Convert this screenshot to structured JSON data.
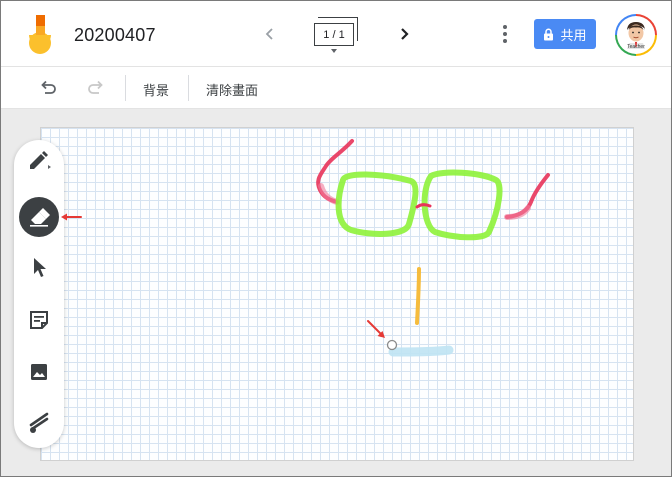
{
  "header": {
    "file_title": "20200407",
    "frame_counter": "1 / 1",
    "share_label": "共用",
    "avatar_caption": "Teacher"
  },
  "toolbar": {
    "background_label": "背景",
    "clear_label": "清除畫面"
  },
  "tools": [
    {
      "name": "pen-tool",
      "icon": "pen-icon",
      "active": false
    },
    {
      "name": "eraser-tool",
      "icon": "eraser-icon",
      "active": true
    },
    {
      "name": "select-tool",
      "icon": "cursor-arrow-icon",
      "active": false
    },
    {
      "name": "sticky-note-tool",
      "icon": "sticky-note-icon",
      "active": false
    },
    {
      "name": "image-tool",
      "icon": "image-icon",
      "active": false
    },
    {
      "name": "laser-tool",
      "icon": "laser-icon",
      "active": false
    }
  ],
  "colors": {
    "share_button": "#4a8af4",
    "active_tool": "#3c4043",
    "glasses_frame": "#8ef23a",
    "glasses_arms": "#e8335a",
    "nose": "#f5b833",
    "mouth": "#bfe3f3",
    "annotation_arrow": "#e53935"
  }
}
